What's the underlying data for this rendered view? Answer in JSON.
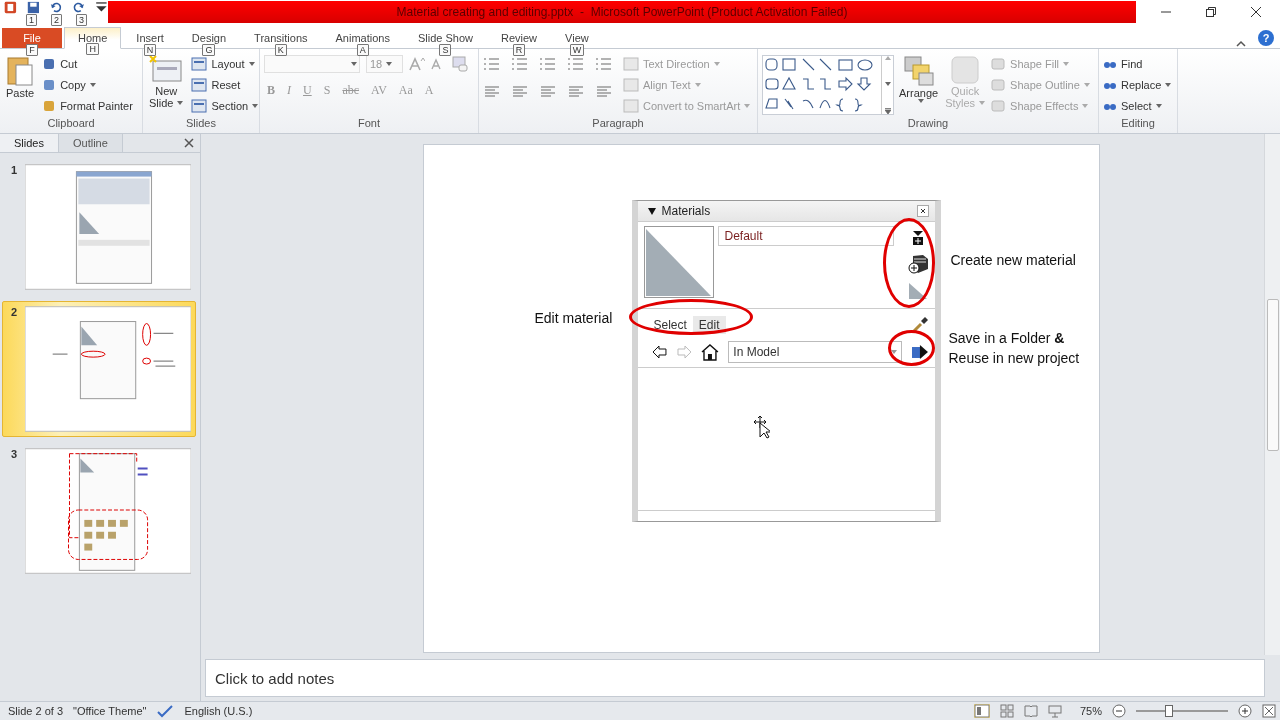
{
  "title_bar": {
    "title": "Material creating and editing.pptx  -  Microsoft PowerPoint (Product Activation Failed)",
    "keytips": [
      "1",
      "2",
      "3"
    ],
    "help": "?"
  },
  "tabs": [
    {
      "label": "File",
      "keytip": "F",
      "kind": "file",
      "selected": false
    },
    {
      "label": "Home",
      "keytip": "H",
      "kind": "tab",
      "selected": true
    },
    {
      "label": "Insert",
      "keytip": "N",
      "kind": "tab",
      "selected": false
    },
    {
      "label": "Design",
      "keytip": "G",
      "kind": "tab",
      "selected": false
    },
    {
      "label": "Transitions",
      "keytip": "K",
      "kind": "tab",
      "selected": false
    },
    {
      "label": "Animations",
      "keytip": "A",
      "kind": "tab",
      "selected": false
    },
    {
      "label": "Slide Show",
      "keytip": "S",
      "kind": "tab",
      "selected": false
    },
    {
      "label": "Review",
      "keytip": "R",
      "kind": "tab",
      "selected": false
    },
    {
      "label": "View",
      "keytip": "W",
      "kind": "tab",
      "selected": false
    }
  ],
  "ribbon": {
    "clipboard": {
      "name": "Clipboard",
      "paste": "Paste",
      "items": [
        {
          "label": "Cut",
          "dropdown": false
        },
        {
          "label": "Copy",
          "dropdown": true
        },
        {
          "label": "Format Painter",
          "dropdown": false
        }
      ]
    },
    "slides": {
      "name": "Slides",
      "new_slide": [
        "New",
        "Slide"
      ],
      "items": [
        {
          "label": "Layout",
          "dropdown": true
        },
        {
          "label": "Reset",
          "dropdown": false
        },
        {
          "label": "Section",
          "dropdown": true
        }
      ]
    },
    "font": {
      "name": "Font",
      "size": "18",
      "format_buttons": [
        "B",
        "I",
        "U",
        "S",
        "abc",
        "AV",
        "Aa",
        "A"
      ]
    },
    "paragraph": {
      "name": "Paragraph",
      "items": [
        {
          "label": "Text Direction",
          "disabled": true
        },
        {
          "label": "Align Text",
          "disabled": true
        },
        {
          "label": "Convert to SmartArt",
          "disabled": true
        }
      ]
    },
    "drawing": {
      "name": "Drawing",
      "arrange": "Arrange",
      "quick_styles": [
        "Quick",
        "Styles"
      ],
      "items": [
        {
          "label": "Shape Fill",
          "disabled": true
        },
        {
          "label": "Shape Outline",
          "disabled": true
        },
        {
          "label": "Shape Effects",
          "disabled": true
        }
      ]
    },
    "editing": {
      "name": "Editing",
      "items": [
        {
          "label": "Find",
          "dropdown": false
        },
        {
          "label": "Replace",
          "dropdown": true
        },
        {
          "label": "Select",
          "dropdown": true
        }
      ]
    }
  },
  "slides_pane": {
    "tabs": [
      {
        "label": "Slides",
        "selected": true
      },
      {
        "label": "Outline",
        "selected": false
      }
    ],
    "thumbnails": [
      {
        "number": "1",
        "kind": "panel",
        "selected": false
      },
      {
        "number": "2",
        "kind": "annotated",
        "selected": true
      },
      {
        "number": "3",
        "kind": "library",
        "selected": false
      }
    ]
  },
  "slide": {
    "panel": {
      "title": "Materials",
      "material_name": "Default",
      "tabs": [
        {
          "label": "Select",
          "selected": true
        },
        {
          "label": "Edit",
          "selected": false
        }
      ],
      "collection": "In Model"
    },
    "callouts": [
      {
        "kind": "edit",
        "lines": [
          "Edit material"
        ]
      },
      {
        "kind": "create",
        "lines": [
          "Create new material"
        ]
      },
      {
        "kind": "save",
        "lines": [
          "Save in a Folder **&**",
          "Reuse in new project"
        ]
      }
    ]
  },
  "notes": {
    "placeholder": "Click to add notes"
  },
  "status_bar": {
    "slide": "Slide 2 of 3",
    "theme": "\"Office Theme\"",
    "language": "English (U.S.)",
    "zoom": "75%",
    "zoom_slider": {
      "level": 0.36
    }
  }
}
